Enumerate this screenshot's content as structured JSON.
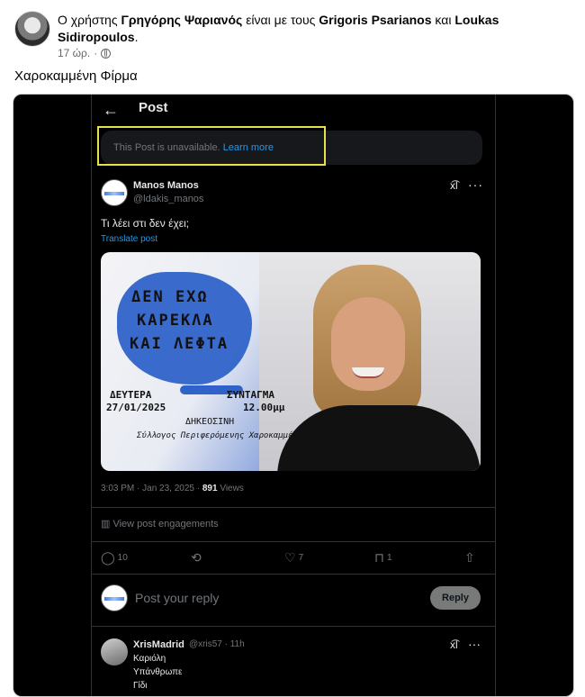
{
  "facebook_post": {
    "header_prefix": "Ο χρήστης",
    "author": "Γρηγόρης Ψαριανός",
    "with_text": "είναι με τους",
    "tagged_1": "Grigoris Psarianos",
    "and_text": "και",
    "tagged_2": "Loukas Sidiropoulos",
    "period": ".",
    "time": "17 ώρ.",
    "dot": "·",
    "privacy_icon": "globe-icon",
    "caption": "Χαροκαμμένη Φίρμα"
  },
  "x_screenshot": {
    "back_icon": "←",
    "title": "Post",
    "unavailable_text": "This Post is unavailable.",
    "learn_more": "Learn more",
    "author_name": "Manos Manos",
    "author_handle": "@ldakis_manos",
    "grok_icon": "x͡l",
    "more_icon": "···",
    "text": "Τι λέει στι δεν έχει;",
    "translate": "Translate post",
    "poster": {
      "line1": "ΔΕΝ ΕΧΩ",
      "line2": "ΚΑΡΕΚΛΑ",
      "line3": "ΚΑΙ ΛΕΦΤΑ",
      "day": "ΔΕΥΤΕΡΑ",
      "date": "27/01/2025",
      "place": "ΣΥΝΤΑΓΜΑ",
      "time": "12.00μμ",
      "org_short": "ΔΗΚΕΟΣΙΝΗ",
      "org": "Σύλλογος Περιφερόμενης Χαροκαμμένης"
    },
    "timestamp": "3:03 PM · Jan 23, 2025 ·",
    "views_count": "891",
    "views_label": "Views",
    "engagements": "View post engagements",
    "actions": {
      "reply_icon": "💬",
      "reply_count": "10",
      "repost_icon": "⟲",
      "like_icon": "♡",
      "like_count": "7",
      "bookmark_icon": "⊓",
      "bookmark_count": "1",
      "share_icon": "⇧"
    },
    "reply_placeholder": "Post your reply",
    "reply_button": "Reply",
    "reply": {
      "name": "XrisMadrid",
      "handle": "@xris57 · 11h",
      "line1": "Καριόλη",
      "line2": "Υπάνθρωπε",
      "line3": "Γίδι"
    }
  },
  "colors": {
    "highlight": "#e8e04a",
    "x_blue": "#1d9bf0",
    "x_bg": "#000000"
  }
}
